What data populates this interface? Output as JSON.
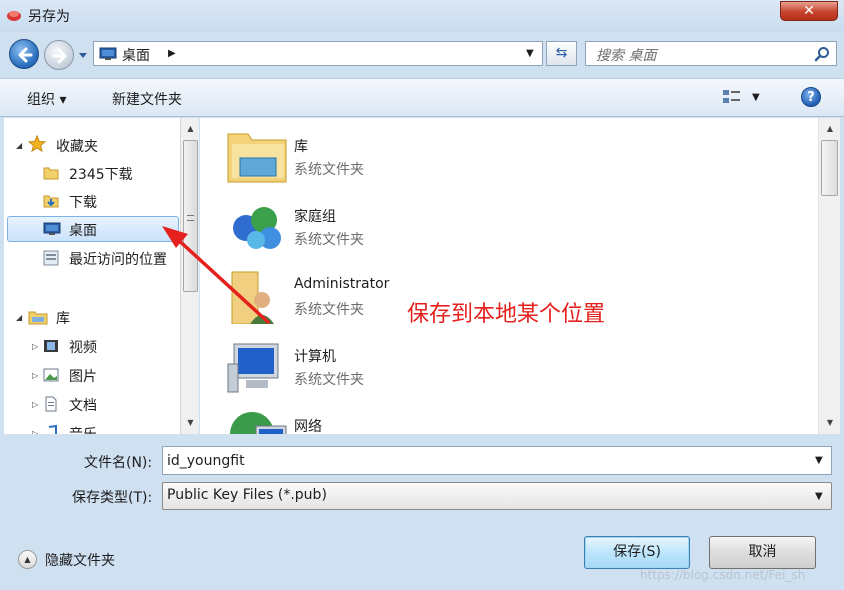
{
  "window": {
    "title": "另存为",
    "close_glyph": "✕"
  },
  "address": {
    "location": "桌面",
    "search_placeholder": "搜索 桌面"
  },
  "toolbar": {
    "organize": "组织 ▾",
    "new_folder": "新建文件夹",
    "help": "?"
  },
  "nav": {
    "favorites": "收藏夹",
    "fav_items": [
      "2345下载",
      "下载",
      "桌面",
      "最近访问的位置"
    ],
    "libraries": "库",
    "lib_items": [
      "视频",
      "图片",
      "文档",
      "音乐"
    ]
  },
  "content": {
    "items": [
      {
        "name": "库",
        "type": "系统文件夹",
        "icon": "library-icon"
      },
      {
        "name": "家庭组",
        "type": "系统文件夹",
        "icon": "homegroup-icon"
      },
      {
        "name": "Administrator",
        "type": "系统文件夹",
        "icon": "user-folder-icon"
      },
      {
        "name": "计算机",
        "type": "系统文件夹",
        "icon": "computer-icon"
      },
      {
        "name": "网络",
        "type": "",
        "icon": "network-icon"
      }
    ]
  },
  "annotation": {
    "text": "保存到本地某个位置",
    "color": "#e5211e"
  },
  "form": {
    "filename_label": "文件名(N):",
    "filename_value": "id_youngfit",
    "filetype_label": "保存类型(T):",
    "filetype_value": "Public Key Files (*.pub)"
  },
  "footer": {
    "hide_folders": "隐藏文件夹",
    "save": "保存(S)",
    "cancel": "取消",
    "watermark": "https://blog.csdn.net/Fei_sh"
  }
}
